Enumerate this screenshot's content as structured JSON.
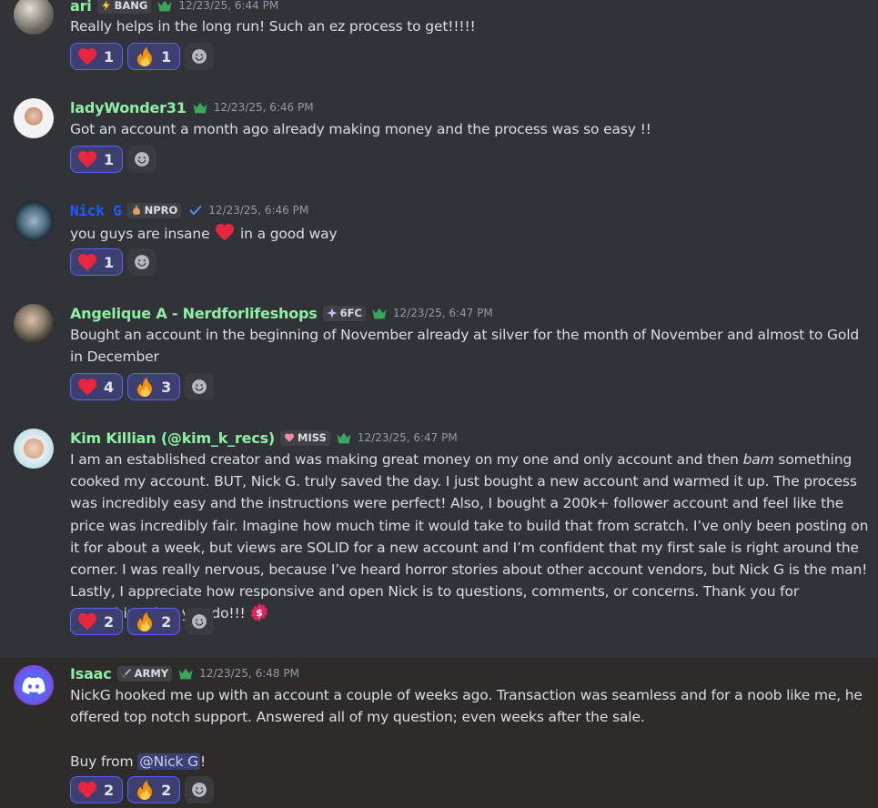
{
  "messages": [
    {
      "username": "ari",
      "name_color": "#8ff0a4",
      "tag": {
        "icon": "lightning-icon",
        "label": "BANG"
      },
      "crown": true,
      "timestamp": "12/23/25, 6:44 PM",
      "text": "Really helps in the long run! Such an ez process to get!!!!!",
      "reactions": [
        {
          "emoji": "heart-emoji",
          "count": "1"
        },
        {
          "emoji": "fire-emoji",
          "count": "1"
        }
      ]
    },
    {
      "username": "ladyWonder31",
      "name_color": "#8ff0a4",
      "crown": true,
      "timestamp": "12/23/25, 6:46 PM",
      "text": "Got an account a month ago already making money and the process was so easy !!",
      "reactions": [
        {
          "emoji": "heart-emoji",
          "count": "1"
        }
      ]
    },
    {
      "username": "Nick G",
      "name_color": "#1f5cff",
      "tag": {
        "icon": "money-bag-icon",
        "label": "NPRO"
      },
      "verified": true,
      "timestamp": "12/23/25, 6:46 PM",
      "text_before": "you guys are insane",
      "text_after": "in a good way",
      "reactions": [
        {
          "emoji": "heart-emoji",
          "count": "1"
        }
      ]
    },
    {
      "username": "Angelique A - Nerdforlifeshops",
      "name_color": "#8ff0a4",
      "tag": {
        "icon": "sparkle-diamond-icon",
        "label": "6FC"
      },
      "crown": true,
      "timestamp": "12/23/25, 6:47 PM",
      "text": "Bought an account in the beginning of November already at silver for the month of November and almost to Gold in December",
      "reactions": [
        {
          "emoji": "heart-emoji",
          "count": "4"
        },
        {
          "emoji": "fire-emoji",
          "count": "3"
        }
      ]
    },
    {
      "username": "Kim Killian (@kim_k_recs)",
      "name_color": "#8ff0a4",
      "tag": {
        "icon": "heart-icon",
        "label": "MISS"
      },
      "crown": true,
      "timestamp": "12/23/25, 6:47 PM",
      "text_before": "I am an established creator and was making great money on my one and only account and then ",
      "text_italic": "bam",
      "text_after": " something cooked my account. BUT, Nick G. truly saved the day. I just bought a new account and warmed it up. The process was incredibly easy and the instructions were perfect! Also, I bought a 200k+ follower account and feel like the price was incredibly fair. Imagine how much time it would take to build that from scratch. I’ve only been posting on it for about a week, but views are SOLID for a new account and I’m confident that my first sale is right around the corner. I was really nervous, because I’ve heard horror stories about other account vendors, but Nick G is the man! Lastly, I appreciate how responsive and open Nick is to questions, comments, or concerns. Thank you for everything that you do!!!",
      "reactions": [
        {
          "emoji": "heart-emoji",
          "count": "2"
        },
        {
          "emoji": "fire-emoji",
          "count": "2"
        }
      ]
    },
    {
      "username": "Isaac",
      "name_color": "#8ff0a4",
      "tag": {
        "icon": "sword-icon",
        "label": "ARMY"
      },
      "crown": true,
      "timestamp": "12/23/25, 6:48 PM",
      "text": "NickG hooked me up with an account a couple of weeks ago. Transaction was seamless and for a noob like me, he offered top notch support. Answered all of my question; even weeks after the sale.",
      "text2_before": "Buy from ",
      "mention": "@Nick G",
      "text2_after": "!",
      "reactions": [
        {
          "emoji": "heart-emoji",
          "count": "2"
        },
        {
          "emoji": "fire-emoji",
          "count": "2"
        }
      ]
    }
  ]
}
